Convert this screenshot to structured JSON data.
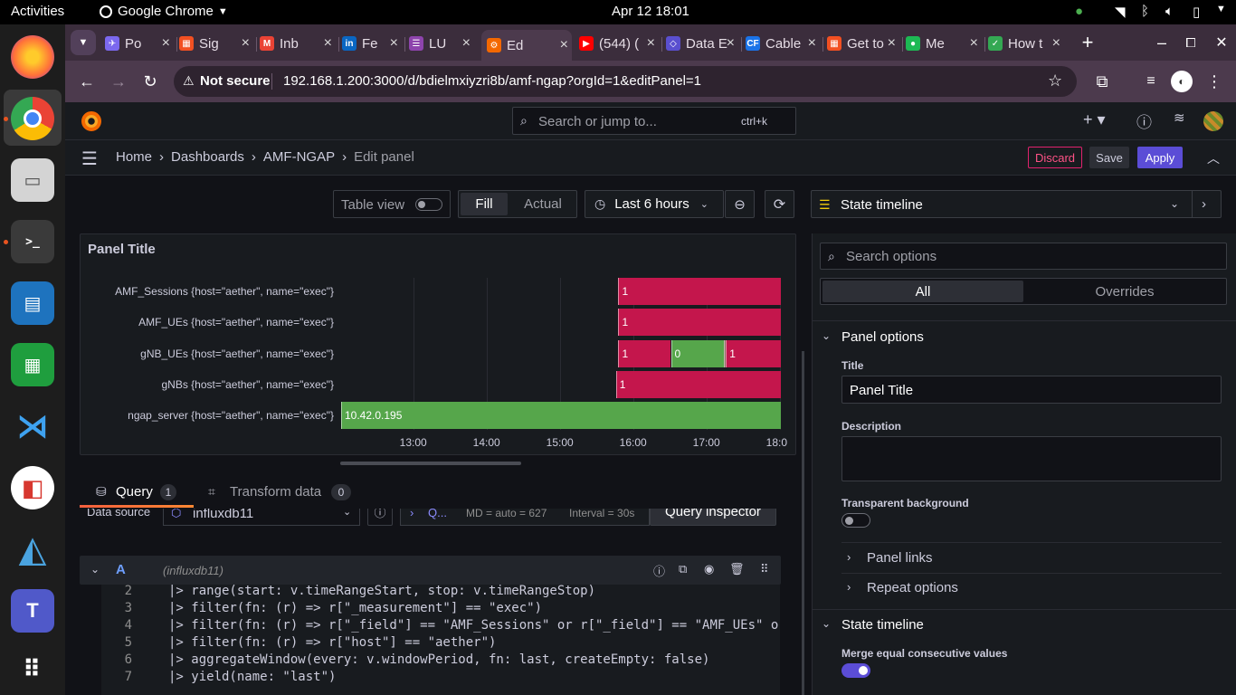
{
  "os": {
    "activities": "Activities",
    "app_menu": "Google Chrome",
    "clock": "Apr 12  18:01"
  },
  "tabs": [
    {
      "label": "Po",
      "color": "#7b68ee",
      "icon": "✈"
    },
    {
      "label": "Sig",
      "color": "#f25022",
      "icon": "▦"
    },
    {
      "label": "Inb",
      "color": "#ea4335",
      "icon": "M"
    },
    {
      "label": "Fe",
      "color": "#0a66c2",
      "icon": "in"
    },
    {
      "label": "LU",
      "color": "#8e44ad",
      "icon": "☰"
    },
    {
      "label": "Ed",
      "color": "#f46800",
      "icon": "⚙"
    },
    {
      "label": "(544) (",
      "color": "#ff0000",
      "icon": "▶"
    },
    {
      "label": "Data E",
      "color": "#5a4fcf",
      "icon": "◇"
    },
    {
      "label": "Cable",
      "color": "#1a73e8",
      "icon": "CF"
    },
    {
      "label": "Get to",
      "color": "#f25022",
      "icon": "▦"
    },
    {
      "label": "Me",
      "color": "#1db954",
      "icon": "●"
    },
    {
      "label": "How t",
      "color": "#34a853",
      "icon": "✓"
    }
  ],
  "address": {
    "security": "Not secure",
    "url": "192.168.1.200:3000/d/bdielmxiyzri8b/amf-ngap?orgId=1&editPanel=1"
  },
  "grafana": {
    "search_placeholder": "Search or jump to...",
    "search_shortcut": "ctrl+k",
    "breadcrumbs": [
      "Home",
      "Dashboards",
      "AMF-NGAP",
      "Edit panel"
    ],
    "discard": "Discard",
    "save": "Save",
    "apply": "Apply",
    "table_view": "Table view",
    "fill": "Fill",
    "actual": "Actual",
    "time_range": "Last 6 hours",
    "viz_type": "State timeline"
  },
  "panel": {
    "title": "Panel Title"
  },
  "chart_data": {
    "type": "state-timeline",
    "x_ticks": [
      "13:00",
      "14:00",
      "15:00",
      "16:00",
      "17:00",
      "18:0"
    ],
    "x_range": [
      "12:01",
      "18:01"
    ],
    "rows": [
      {
        "label": "AMF_Sessions {host=\"aether\", name=\"exec\"}",
        "segments": [
          {
            "start": "15:48",
            "end": "18:01",
            "value": "1",
            "color": "#c4164c"
          }
        ]
      },
      {
        "label": "AMF_UEs {host=\"aether\", name=\"exec\"}",
        "segments": [
          {
            "start": "15:48",
            "end": "18:01",
            "value": "1",
            "color": "#c4164c"
          }
        ]
      },
      {
        "label": "gNB_UEs {host=\"aether\", name=\"exec\"}",
        "segments": [
          {
            "start": "15:48",
            "end": "16:31",
            "value": "1",
            "color": "#c4164c"
          },
          {
            "start": "16:31",
            "end": "17:14",
            "value": "0",
            "color": "#56a64b"
          },
          {
            "start": "17:14",
            "end": "17:16",
            "value": "",
            "color": "#8a7060"
          },
          {
            "start": "17:16",
            "end": "18:01",
            "value": "1",
            "color": "#c4164c"
          }
        ]
      },
      {
        "label": "gNBs {host=\"aether\", name=\"exec\"}",
        "segments": [
          {
            "start": "15:46",
            "end": "18:01",
            "value": "1",
            "color": "#c4164c"
          }
        ]
      },
      {
        "label": "ngap_server {host=\"aether\", name=\"exec\"}",
        "segments": [
          {
            "start": "12:01",
            "end": "18:01",
            "value": "10.42.0.195",
            "color": "#56a64b"
          }
        ]
      }
    ]
  },
  "query_tabs": {
    "query": "Query",
    "query_count": "1",
    "transform": "Transform data",
    "transform_count": "0"
  },
  "query_bar": {
    "datasource_label": "Data source",
    "datasource": "influxdb11",
    "qopts": "Q...",
    "md": "MD = auto = 627",
    "interval": "Interval = 30s",
    "inspector": "Query inspector"
  },
  "query_row": {
    "letter": "A",
    "source": "(influxdb11)"
  },
  "code_lines": [
    {
      "n": "2",
      "text": "  |> range(start: v.timeRangeStart, stop: v.timeRangeStop)"
    },
    {
      "n": "3",
      "text": "  |> filter(fn: (r) => r[\"_measurement\"] == \"exec\")"
    },
    {
      "n": "4",
      "text": "  |> filter(fn: (r) => r[\"_field\"] == \"AMF_Sessions\" or r[\"_field\"] == \"AMF_UEs\" o"
    },
    {
      "n": "5",
      "text": "  |> filter(fn: (r) => r[\"host\"] == \"aether\")"
    },
    {
      "n": "6",
      "text": "  |> aggregateWindow(every: v.windowPeriod, fn: last, createEmpty: false)"
    },
    {
      "n": "7",
      "text": "  |> yield(name: \"last\")"
    }
  ],
  "options": {
    "search_placeholder": "Search options",
    "all": "All",
    "overrides": "Overrides",
    "panel_options": "Panel options",
    "title_label": "Title",
    "title_value": "Panel Title",
    "description_label": "Description",
    "transparent_label": "Transparent background",
    "panel_links": "Panel links",
    "repeat_options": "Repeat options",
    "state_timeline": "State timeline",
    "merge_label": "Merge equal consecutive values"
  }
}
